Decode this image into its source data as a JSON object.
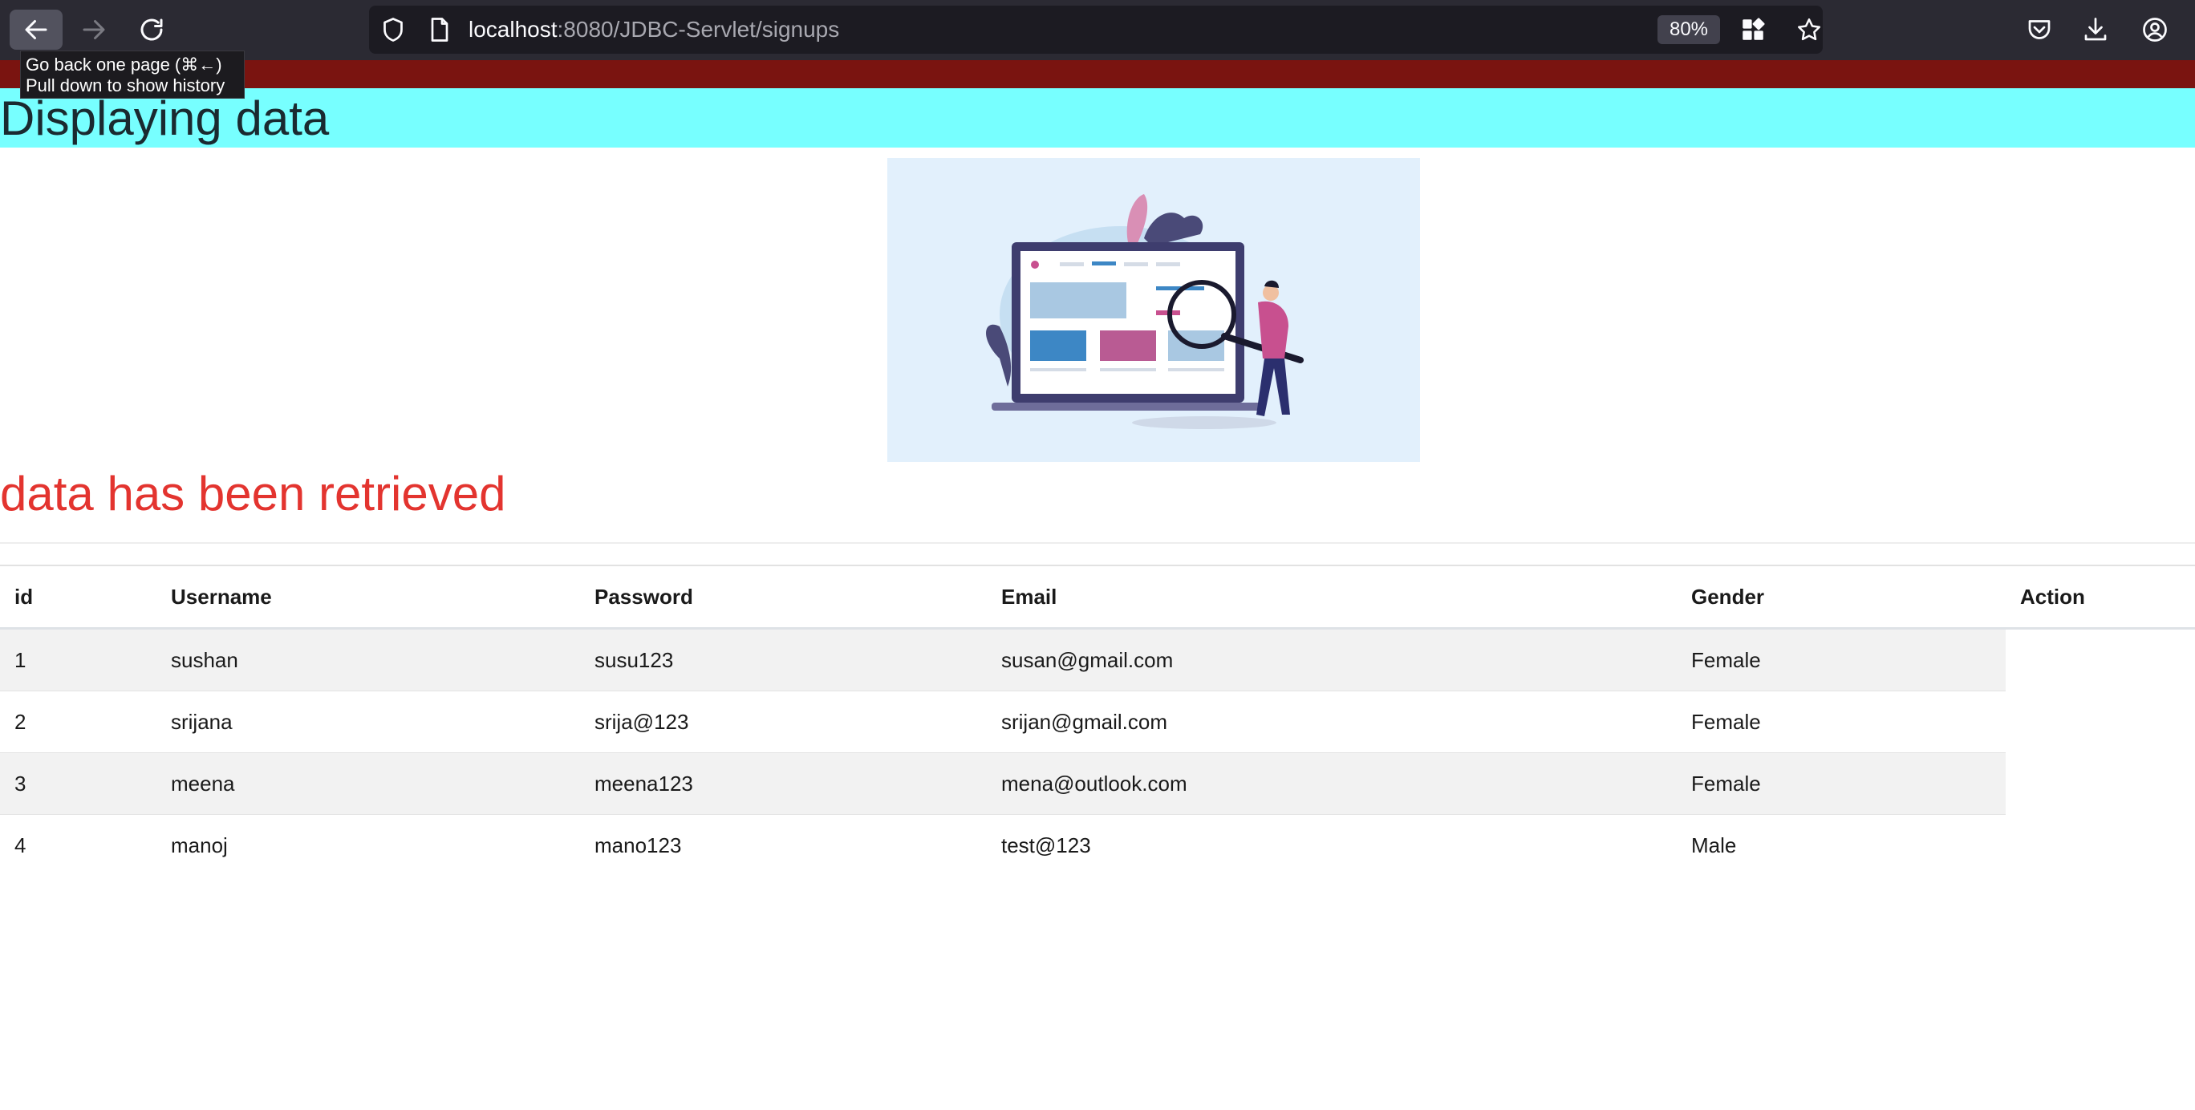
{
  "browser": {
    "url_host": "localhost",
    "url_rest": ":8080/JDBC-Servlet/signups",
    "zoom": "80%",
    "tooltip": {
      "line1": "Go back one page (⌘←)",
      "line2": "Pull down to show history"
    },
    "icons": [
      "back-arrow-icon",
      "forward-arrow-icon",
      "reload-icon",
      "shield-icon",
      "page-icon",
      "qr-code-icon",
      "star-icon",
      "pocket-icon",
      "download-icon",
      "account-icon"
    ]
  },
  "page": {
    "heading": "Displaying data",
    "status_message": "data has been retrieved",
    "colors": {
      "top_bar": "#7a1410",
      "heading_band": "#77ffff",
      "status_message": "#e3342f",
      "stripe": "#f2f2f2"
    }
  },
  "table": {
    "headers": [
      "id",
      "Username",
      "Password",
      "Email",
      "Gender",
      "Action"
    ],
    "rows": [
      [
        "1",
        "sushan",
        "susu123",
        "susan@gmail.com",
        "Female"
      ],
      [
        "2",
        "srijana",
        "srija@123",
        "srijan@gmail.com",
        "Female"
      ],
      [
        "3",
        "meena",
        "meena123",
        "mena@outlook.com",
        "Female"
      ],
      [
        "4",
        "manoj",
        "mano123",
        "test@123",
        "Male"
      ]
    ]
  }
}
